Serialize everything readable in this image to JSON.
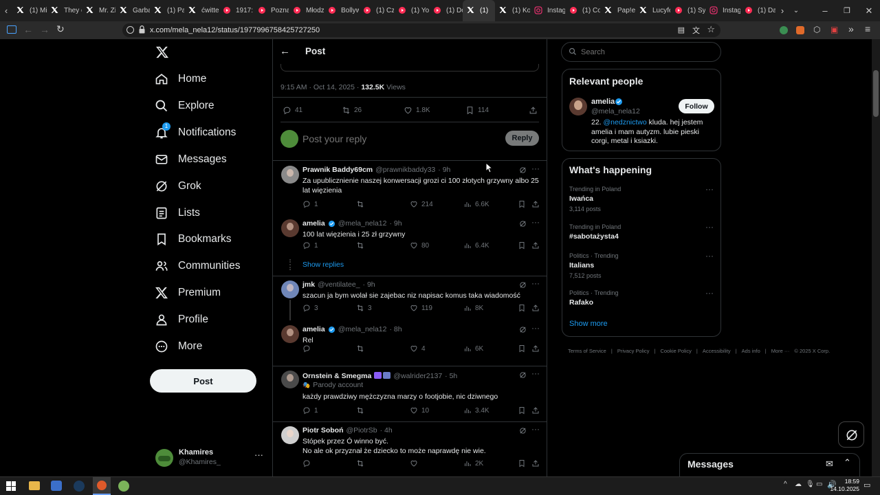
{
  "browser": {
    "tabs": [
      {
        "label": "(1) Mi",
        "icon": "x-icon",
        "color": "#ffffff"
      },
      {
        "label": "They c",
        "icon": "x-icon",
        "color": "#ffffff"
      },
      {
        "label": "Mr. Zi",
        "icon": "x-icon",
        "color": "#ffffff"
      },
      {
        "label": "Garba",
        "icon": "x-icon",
        "color": "#ffffff"
      },
      {
        "label": "(1) Pa",
        "icon": "x-icon",
        "color": "#ffffff"
      },
      {
        "label": "ćwitte",
        "icon": "x-icon",
        "color": "#ffffff"
      },
      {
        "label": "1917:",
        "icon": "youtube-icon",
        "color": "#ff2d55"
      },
      {
        "label": "Pozna",
        "icon": "youtube-icon",
        "color": "#ff2d55"
      },
      {
        "label": "Młodz",
        "icon": "youtube-icon",
        "color": "#ff2d55"
      },
      {
        "label": "Bollyw",
        "icon": "youtube-icon",
        "color": "#ff2d55"
      },
      {
        "label": "(1) Cz",
        "icon": "youtube-icon",
        "color": "#ff2d55"
      },
      {
        "label": "(1) Yo",
        "icon": "youtube-icon",
        "color": "#ff2d55"
      },
      {
        "label": "(1) Do",
        "icon": "youtube-icon",
        "color": "#ff2d55"
      },
      {
        "label": "(1)",
        "icon": "x-icon",
        "color": "#ffffff",
        "active": true
      },
      {
        "label": "(1) Ko",
        "icon": "x-icon",
        "color": "#ffffff"
      },
      {
        "label": "Instag",
        "icon": "instagram-icon",
        "color": "#e1306c"
      },
      {
        "label": "(1) Co",
        "icon": "youtube-icon",
        "color": "#ff2d55"
      },
      {
        "label": "Pap!e:",
        "icon": "x-icon",
        "color": "#ffffff"
      },
      {
        "label": "Lucyfe",
        "icon": "x-icon",
        "color": "#ffffff"
      },
      {
        "label": "(1) Sy",
        "icon": "youtube-icon",
        "color": "#ff2d55"
      },
      {
        "label": "Instag",
        "icon": "instagram-icon",
        "color": "#e1306c"
      },
      {
        "label": "(1) Da",
        "icon": "youtube-icon",
        "color": "#ff2d55"
      }
    ],
    "url": "x.com/mela_nela12/status/1977996758425727250"
  },
  "sidebar": {
    "items": [
      {
        "label": "Home",
        "icon": "home-icon"
      },
      {
        "label": "Explore",
        "icon": "search-icon"
      },
      {
        "label": "Notifications",
        "icon": "bell-icon",
        "badge": "1"
      },
      {
        "label": "Messages",
        "icon": "mail-icon"
      },
      {
        "label": "Grok",
        "icon": "grok-icon"
      },
      {
        "label": "Lists",
        "icon": "list-icon"
      },
      {
        "label": "Bookmarks",
        "icon": "bookmark-icon"
      },
      {
        "label": "Communities",
        "icon": "people-icon"
      },
      {
        "label": "Premium",
        "icon": "x-icon"
      },
      {
        "label": "Profile",
        "icon": "person-icon"
      },
      {
        "label": "More",
        "icon": "more-circle-icon"
      }
    ],
    "post_button": "Post",
    "account": {
      "name": "Khamires",
      "handle": "@Khamires_"
    }
  },
  "main": {
    "header_title": "Post",
    "meta": {
      "time": "9:15 AM · Oct 14, 2025 · ",
      "views_count": "132.5K",
      "views_label": " Views"
    },
    "stats": {
      "replies": "41",
      "reposts": "26",
      "likes": "1.8K",
      "bookmarks": "114"
    },
    "reply_placeholder": "Post your reply",
    "reply_button": "Reply",
    "show_replies": "Show replies",
    "replies": [
      {
        "name": "Prawnik Baddy69cm",
        "handle": "@prawnikbaddy33",
        "time": "· 9h",
        "text": "Za upublicznienie naszej konwersacji grozi ci 100 złotych grzywny albo 25 lat więzienia",
        "replies": "1",
        "reposts": "",
        "likes": "214",
        "views": "6.6K",
        "verified": false,
        "avatar": "#8a8a8a"
      },
      {
        "name": "amelia",
        "handle": "@mela_nela12",
        "time": "· 9h",
        "text": "100 lat więzienia i 25 zł grzywny",
        "replies": "1",
        "reposts": "",
        "likes": "80",
        "views": "6.4K",
        "verified": true,
        "avatar": "#5a3a30"
      },
      {
        "name": "jmk",
        "handle": "@ventilatee_",
        "time": "· 9h",
        "text": "szacun ja bym wolał sie zajebac niz napisac komus taka wiadomość",
        "replies": "3",
        "reposts": "3",
        "likes": "119",
        "views": "8K",
        "verified": false,
        "avatar": "#6f86b8"
      },
      {
        "name": "amelia",
        "handle": "@mela_nela12",
        "time": "· 8h",
        "text": "Rel",
        "replies": "",
        "reposts": "",
        "likes": "4",
        "views": "6K",
        "verified": true,
        "avatar": "#5a3a30"
      },
      {
        "name": "Ornstein & Smegma",
        "handle": "@walrider2137",
        "time": "· 5h",
        "parody": "Parody account",
        "text": "każdy prawdziwy mężczyzna marzy o footjobie, nic dziwnego",
        "replies": "1",
        "reposts": "",
        "likes": "10",
        "views": "3.4K",
        "verified": false,
        "avatar": "#4a4a4a"
      },
      {
        "name": "Piotr Soboń",
        "handle": "@PiotrSb",
        "time": "· 4h",
        "text": "Stópek przez Ó winno być.",
        "text2": "No ale ok przyznał że dziecko to może naprawdę nie wie.",
        "replies": "",
        "reposts": "",
        "likes": "",
        "views": "2K",
        "verified": false,
        "avatar": "#cfcfcf"
      }
    ]
  },
  "right": {
    "search_placeholder": "Search",
    "relevant_title": "Relevant people",
    "person": {
      "name": "amelia",
      "handle": "@mela_nela12",
      "follow": "Follow",
      "bio_prefix": "22. ",
      "bio_mention": "@nedznictwo",
      "bio_rest": " kluda. hej jestem amelia i mam autyzm. lubie pieski corgi, metal i ksiazki."
    },
    "happening_title": "What's happening",
    "trends": [
      {
        "category": "Trending in Poland",
        "name": "Iwańca",
        "count": "3,114 posts"
      },
      {
        "category": "Trending in Poland",
        "name": "#sabotażysta4",
        "count": ""
      },
      {
        "category": "Politics · Trending",
        "name": "Italians",
        "count": "7,512 posts"
      },
      {
        "category": "Politics · Trending",
        "name": "Rafako",
        "count": ""
      }
    ],
    "show_more": "Show more",
    "footer_links": [
      "Terms of Service",
      "|",
      "Privacy Policy",
      "|",
      "Cookie Policy",
      "|",
      "Accessibility",
      "|",
      "Ads info",
      "|",
      "More ···",
      "© 2025 X Corp."
    ],
    "messages_label": "Messages"
  },
  "taskbar": {
    "time": "18:59",
    "date": "14.10.2025"
  },
  "colors": {
    "accent": "#1d9bf0",
    "link": "#1d9bf0",
    "muted": "#71767b",
    "border": "#2f3336"
  }
}
